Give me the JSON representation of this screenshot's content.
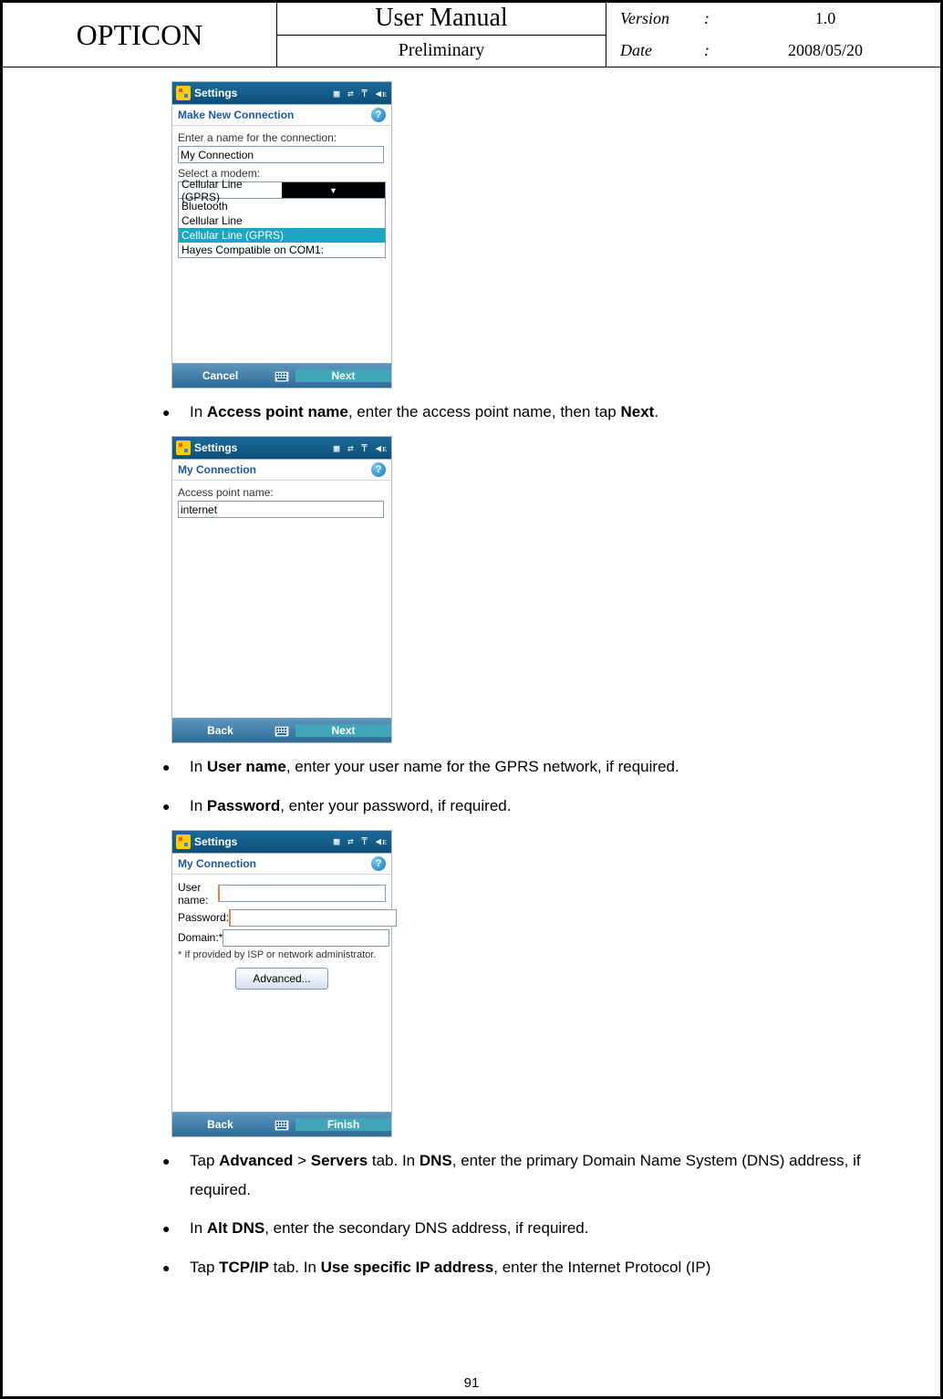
{
  "header": {
    "brand": "OPTICON",
    "title_top": "User Manual",
    "title_bottom": "Preliminary",
    "version_label": "Version",
    "version_value": "1.0",
    "date_label": "Date",
    "date_value": "2008/05/20"
  },
  "screenshots": {
    "s1": {
      "app_title": "Settings",
      "sub_title": "Make New Connection",
      "label_name": "Enter a name for the connection:",
      "name_value": "My Connection",
      "label_modem": "Select a modem:",
      "modem_value": "Cellular Line (GPRS)",
      "options": [
        "Bluetooth",
        "Cellular Line",
        "Cellular Line (GPRS)",
        "Hayes Compatible on COM1:"
      ],
      "bottom_left": "Cancel",
      "bottom_right": "Next"
    },
    "s2": {
      "app_title": "Settings",
      "sub_title": "My Connection",
      "label_apn": "Access point name:",
      "apn_value": "internet",
      "bottom_left": "Back",
      "bottom_right": "Next"
    },
    "s3": {
      "app_title": "Settings",
      "sub_title": "My Connection",
      "label_user": "User name:",
      "label_pass": "Password:",
      "label_domain": "Domain:*",
      "note": "* If provided by ISP or network administrator.",
      "adv_button": "Advanced...",
      "bottom_left": "Back",
      "bottom_right": "Finish"
    }
  },
  "bullets": {
    "b1_pre": "In ",
    "b1_bold": "Access point name",
    "b1_post": ", enter the access point name, then tap ",
    "b1_bold2": "Next",
    "b1_end": ".",
    "b2_pre": "In ",
    "b2_bold": "User name",
    "b2_post": ", enter your user name for the GPRS network, if required.",
    "b3_pre": "In ",
    "b3_bold": "Password",
    "b3_post": ", enter your password, if required.",
    "b4_pre": "Tap ",
    "b4_bold": "Advanced",
    "b4_mid": " > ",
    "b4_bold2": "Servers",
    "b4_post": " tab. In ",
    "b4_bold3": "DNS",
    "b4_post2": ", enter the primary Domain Name System (DNS) address, if required.",
    "b5_pre": "In ",
    "b5_bold": "Alt DNS",
    "b5_post": ", enter the secondary DNS address, if required.",
    "b6_pre": "Tap ",
    "b6_bold": "TCP/IP",
    "b6_post": " tab. In ",
    "b6_bold2": "Use specific IP address",
    "b6_post2": ", enter the Internet Protocol (IP)"
  },
  "page_number": "91"
}
